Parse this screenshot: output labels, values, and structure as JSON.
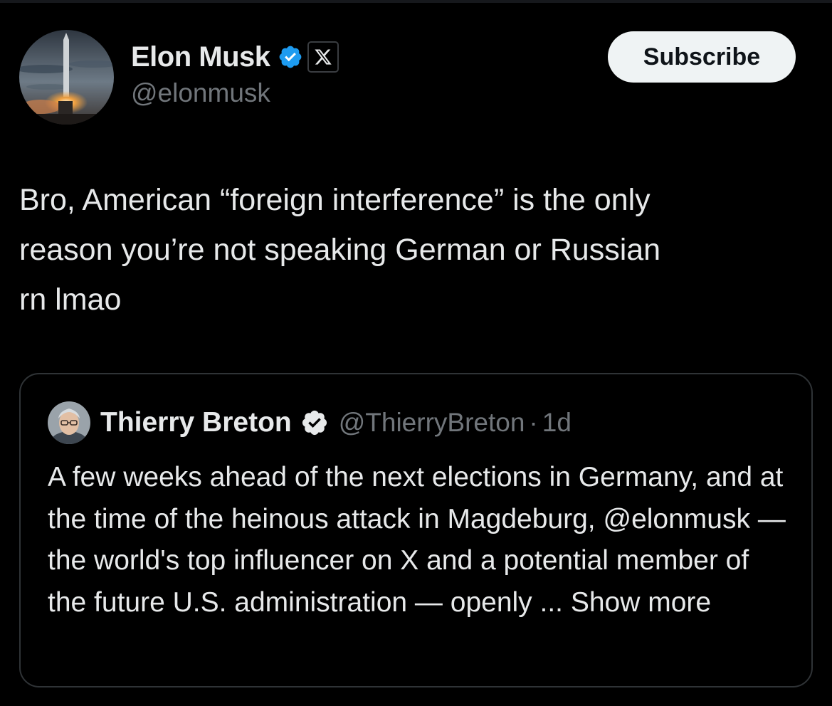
{
  "tweet": {
    "author": {
      "display_name": "Elon Musk",
      "handle": "@elonmusk",
      "verified": true,
      "affiliation_badge": "X"
    },
    "subscribe_label": "Subscribe",
    "text": "Bro, American “foreign interference” is the only\nreason you’re not speaking German or Russian\nrn lmao"
  },
  "quoted_tweet": {
    "author": {
      "display_name": "Thierry Breton",
      "handle": "@ThierryBreton",
      "verified": true
    },
    "separator": "·",
    "time": "1d",
    "text": "A few weeks ahead of the next elections in Germany, and at the time of the heinous attack in Magdeburg, @elonmusk — the world's top influencer on X and a potential member of the future U.S. administration — openly ...",
    "show_more_label": "Show more"
  },
  "colors": {
    "background": "#000000",
    "text_primary": "#e7e9ea",
    "text_secondary": "#71767b",
    "verified_blue": "#1d9bf0",
    "border": "#2f3336",
    "button_bg": "#eff3f4",
    "button_text": "#0f1419"
  },
  "icons": {
    "verified": "verified-badge-icon",
    "affiliation": "x-logo-icon"
  }
}
